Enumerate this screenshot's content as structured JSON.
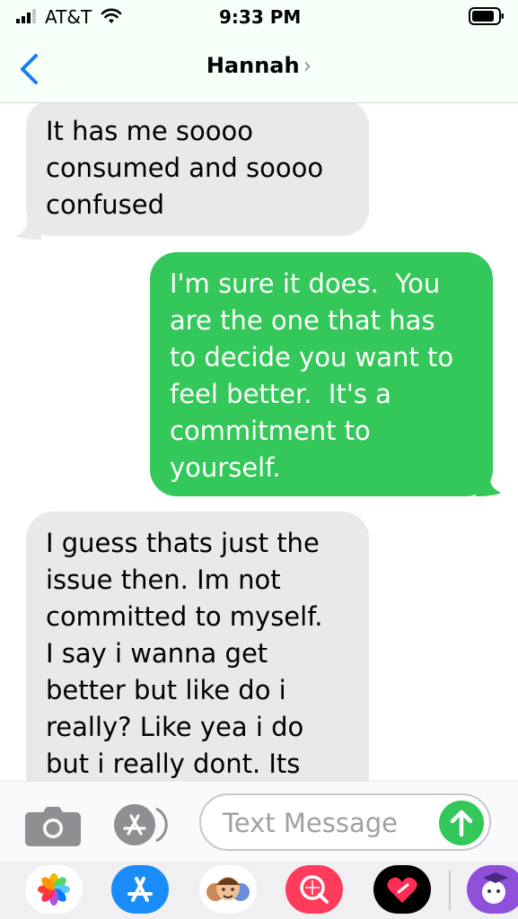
{
  "status_bar": {
    "carrier": "AT&T",
    "time": "9:33 PM"
  },
  "nav": {
    "contact_name": "Hannah",
    "chevron": "›"
  },
  "messages": [
    {
      "direction": "incoming",
      "text": "It has me soooo\nconsumed and soooo\nconfused"
    },
    {
      "direction": "outgoing",
      "text": "I'm sure it does.  You\nare the one that has\nto decide you want to\nfeel better.  It's a\ncommitment to\nyourself."
    },
    {
      "direction": "incoming",
      "text": "I guess thats just the\nissue then. Im not\ncommitted to myself.\nI say i wanna get\nbetter but like do i\nreally? Like yea i do\nbut i really dont. Its"
    }
  ],
  "input_bar": {
    "placeholder": "Text Message"
  },
  "colors": {
    "outgoing_bubble": "#34c759",
    "incoming_bubble": "#e9e9eb",
    "accent": "#1a7cf7"
  },
  "app_tray": [
    {
      "icon": "photos-icon"
    },
    {
      "icon": "app-store-icon"
    },
    {
      "icon": "memoji-icon"
    },
    {
      "icon": "search-images-icon"
    },
    {
      "icon": "digital-touch-icon"
    },
    {
      "icon": "sticker-app-icon"
    }
  ]
}
